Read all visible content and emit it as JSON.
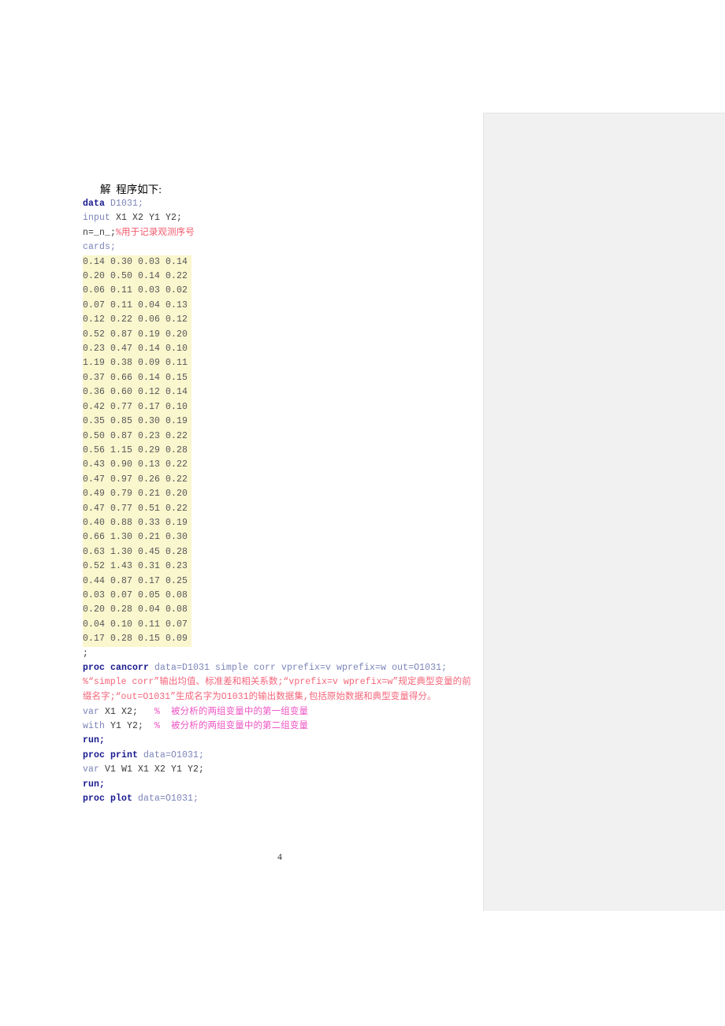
{
  "document": {
    "page_number": "4",
    "intro_line": "解  程序如下:"
  },
  "code": {
    "line_data_stmt_kw": "data",
    "line_data_stmt_arg": " D1031;",
    "line_input_kw": "input",
    "line_input_arg": " X1 X2 Y1 Y2;",
    "line_n_code": "n=_n_;",
    "line_n_comment": "%用于记录观测序号",
    "line_cards": "cards;",
    "data_rows": [
      "0.14 0.30 0.03 0.14",
      "0.20 0.50 0.14 0.22",
      "0.06 0.11 0.03 0.02",
      "0.07 0.11 0.04 0.13",
      "0.12 0.22 0.06 0.12",
      "0.52 0.87 0.19 0.20",
      "0.23 0.47 0.14 0.10",
      "1.19 0.38 0.09 0.11",
      "0.37 0.66 0.14 0.15",
      "0.36 0.60 0.12 0.14",
      "0.42 0.77 0.17 0.10",
      "0.35 0.85 0.30 0.19",
      "0.50 0.87 0.23 0.22",
      "0.56 1.15 0.29 0.28",
      "0.43 0.90 0.13 0.22",
      "0.47 0.97 0.26 0.22",
      "0.49 0.79 0.21 0.20",
      "0.47 0.77 0.51 0.22",
      "0.40 0.88 0.33 0.19",
      "0.66 1.30 0.21 0.30",
      "0.63 1.30 0.45 0.28",
      "0.52 1.43 0.31 0.23",
      "0.44 0.87 0.17 0.25",
      "0.03 0.07 0.05 0.08",
      "0.20 0.28 0.04 0.08",
      "0.04 0.10 0.11 0.07",
      "0.17 0.28 0.15 0.09"
    ],
    "terminator": ";",
    "line_cancorr_kw": "proc cancorr",
    "line_cancorr_arg": " data=D1031 simple corr vprefix=v wprefix=w out=O1031;",
    "cancorr_comment": "%“simple corr”输出均值、标准差和相关系数;“vprefix=v wprefix=w”规定典型变量的前缀名字;“out=O1031”生成名字为O1031的输出数据集,包括原始数据和典型变量得分。",
    "line_var_kw": "var",
    "line_var_arg": " X1 X2;",
    "line_var_comment": "%  被分析的两组变量中的第一组变量",
    "line_with_kw": "with",
    "line_with_arg": " Y1 Y2;",
    "line_with_comment": "%  被分析的两组变量中的第二组变量",
    "line_run1": "run;",
    "line_print_kw": "proc print",
    "line_print_arg": " data=O1031;",
    "line_var2_kw": "var",
    "line_var2_arg": " V1 W1 X1 X2 Y1 Y2;",
    "line_run2": "run;",
    "line_plot_kw": "proc plot",
    "line_plot_arg": " data=O1031;"
  },
  "colors": {
    "keyword": "#17188e",
    "identifier": "#7b84b8",
    "comment_red": "#f25c6e",
    "comment_pink": "#ee55c4",
    "data_highlight": "#faf6cd",
    "margin_pane": "#f1f1f1"
  }
}
